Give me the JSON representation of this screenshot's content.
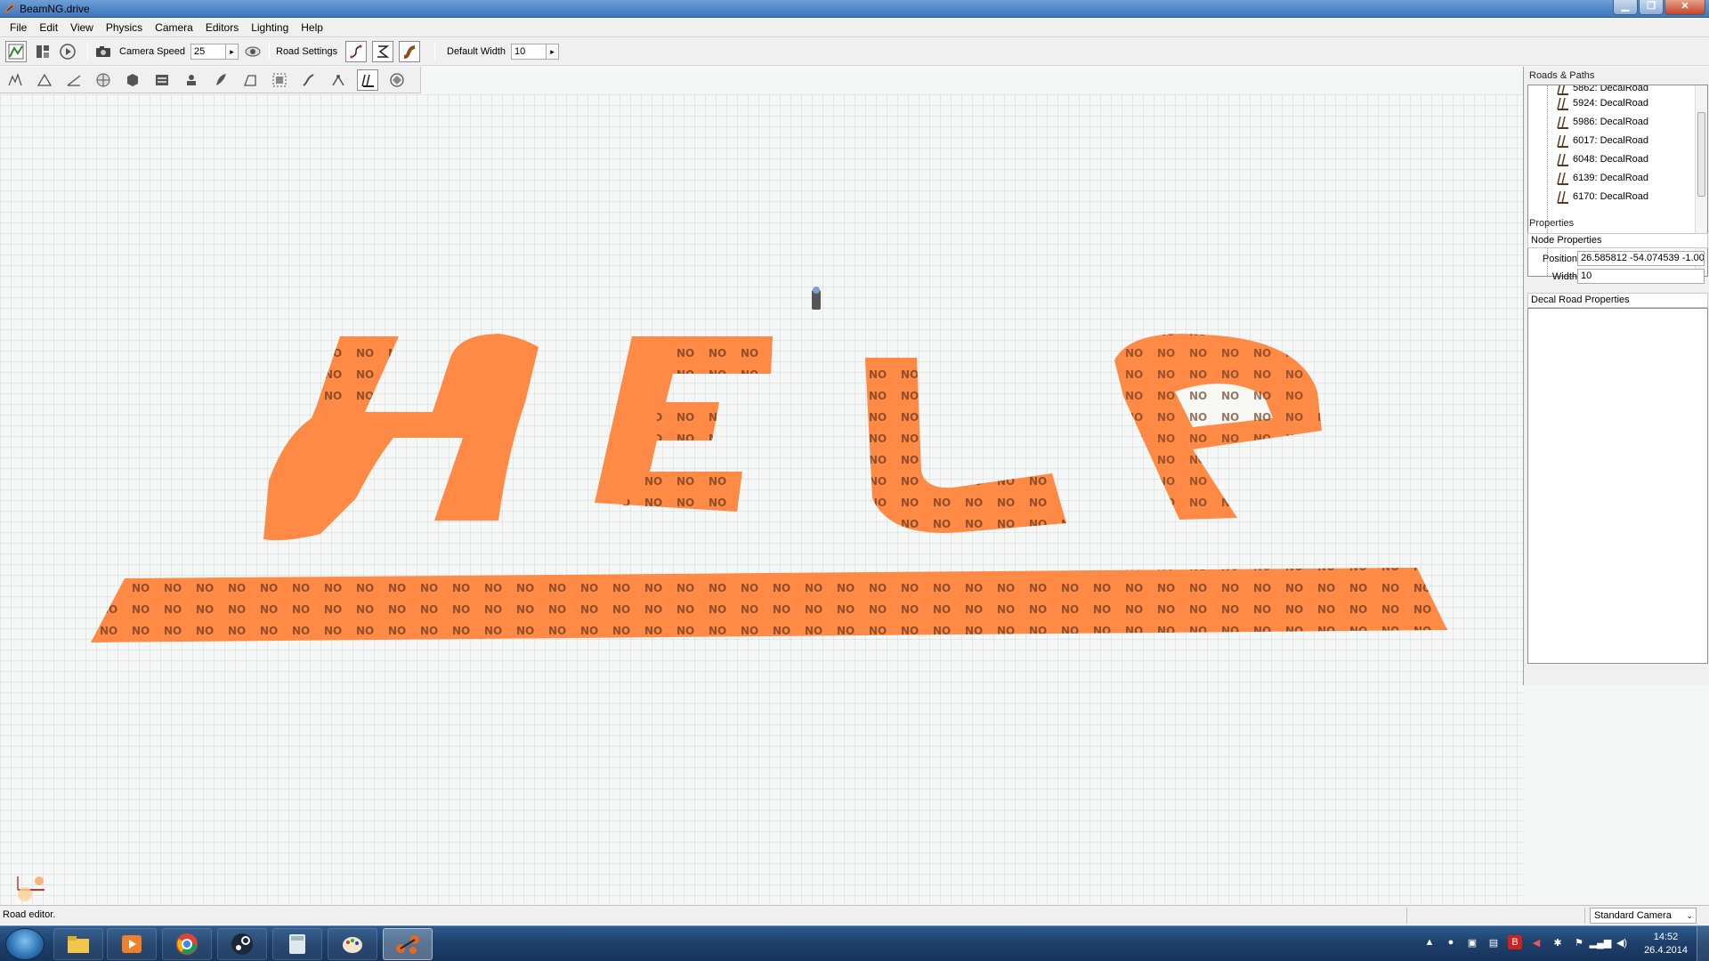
{
  "window": {
    "title": "BeamNG.drive",
    "min_label": "▁",
    "max_label": "❐",
    "close_label": "✕"
  },
  "menu": [
    "File",
    "Edit",
    "View",
    "Physics",
    "Camera",
    "Editors",
    "Lighting",
    "Help"
  ],
  "toolbar": {
    "camera_speed_label": "Camera Speed",
    "camera_speed_value": "25",
    "road_settings_label": "Road Settings",
    "default_width_label": "Default Width",
    "default_width_value": "10",
    "arrow": "▸"
  },
  "viewport": {
    "road_word": "HELP",
    "decal_text": "NO"
  },
  "right_panel": {
    "roads_header": "Roads & Paths",
    "tree_items": [
      "5862: DecalRoad",
      "5924: DecalRoad",
      "5986: DecalRoad",
      "6017: DecalRoad",
      "6048: DecalRoad",
      "6139: DecalRoad",
      "6170: DecalRoad"
    ],
    "properties_header": "Properties",
    "node_properties": "Node Properties",
    "position_label": "Position",
    "position_value": "26.585812 -54.074539 -1.000",
    "width_label": "Width",
    "width_value": "10",
    "decal_road_properties": "Decal Road Properties"
  },
  "status": {
    "text": "Road editor.",
    "camera": "Standard Camera",
    "dropdown": "⌄"
  },
  "taskbar": {
    "time": "14:52",
    "date": "26.4.2014",
    "apps": [
      "explorer",
      "media-player",
      "chrome",
      "steam",
      "calculator",
      "paint",
      "beamng"
    ]
  },
  "colors": {
    "road_orange": "#ff8a45",
    "road_orange_dark": "#f07a35",
    "accent_blue": "#3f77b9"
  }
}
